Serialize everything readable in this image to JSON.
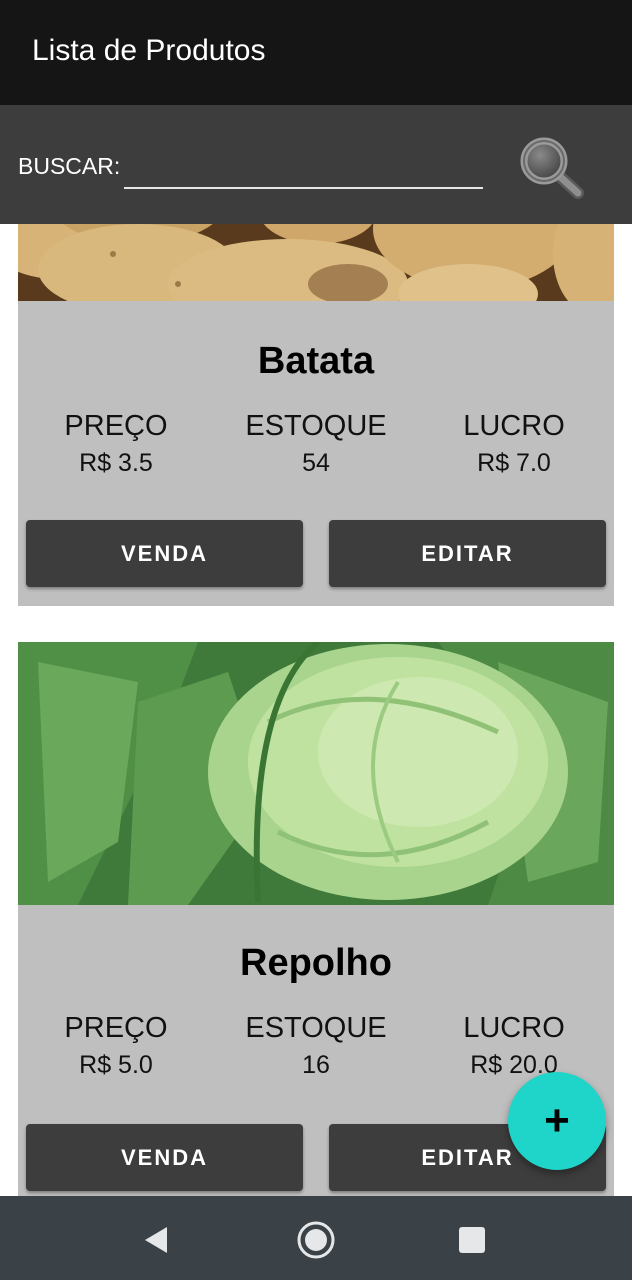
{
  "app": {
    "title": "Lista de Produtos"
  },
  "search": {
    "label": "BUSCAR:",
    "value": "",
    "placeholder": "",
    "icon": "search-icon"
  },
  "products": [
    {
      "name": "Batata",
      "price_label": "PREÇO",
      "price": "R$ 3.5",
      "stock_label": "ESTOQUE",
      "stock": "54",
      "profit_label": "LUCRO",
      "profit": "R$ 7.0",
      "sell_label": "VENDA",
      "edit_label": "EDITAR",
      "image": "potatoes"
    },
    {
      "name": "Repolho",
      "price_label": "PREÇO",
      "price": "R$ 5.0",
      "stock_label": "ESTOQUE",
      "stock": "16",
      "profit_label": "LUCRO",
      "profit": "R$ 20.0",
      "sell_label": "VENDA",
      "edit_label": "EDITAR",
      "image": "cabbage"
    }
  ],
  "fab": {
    "label": "+",
    "icon": "add-icon"
  },
  "navbar": {
    "icons": [
      "back-icon",
      "home-icon",
      "recents-icon"
    ]
  },
  "colors": {
    "appbar": "#151515",
    "searchbar": "#3d3d3d",
    "card": "#bfbfbf",
    "button": "#3d3d3d",
    "fab": "#1fd5c9",
    "navbar": "#3a4147"
  }
}
